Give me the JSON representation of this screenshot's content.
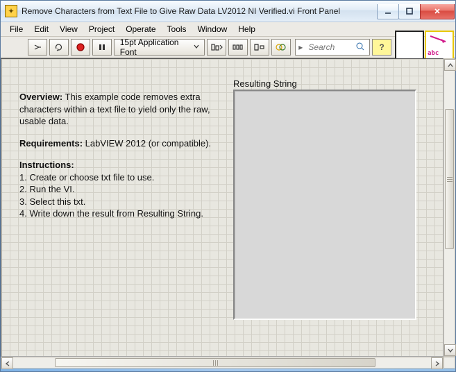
{
  "window_title": "Remove Characters from Text File to Give Raw Data LV2012 NI Verified.vi Front Panel",
  "menu": {
    "file": "File",
    "edit": "Edit",
    "view": "View",
    "project": "Project",
    "operate": "Operate",
    "tools": "Tools",
    "window": "Window",
    "help": "Help"
  },
  "toolbar": {
    "font_label": "15pt Application Font",
    "search_placeholder": "Search",
    "corner_abc": "abc"
  },
  "panel": {
    "overview_label": "Overview:",
    "overview_text": " This example code removes extra characters within a text file to yield only the raw, usable data.",
    "req_label": "Requirements:",
    "req_text": " LabVIEW 2012 (or compatible).",
    "instr_label": "Instructions:",
    "instr_1": "1. Create or choose txt file to use.",
    "instr_2": "2. Run the VI.",
    "instr_3": "3. Select this txt.",
    "instr_4": "4. Write down the result from Resulting String.",
    "out_label": "Resulting String",
    "out_value": ""
  }
}
